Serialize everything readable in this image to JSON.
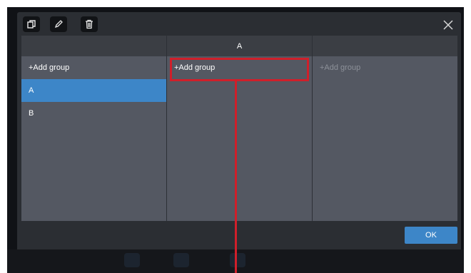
{
  "toolbar": {
    "copy_icon": "copy-icon",
    "edit_icon": "pencil-icon",
    "delete_icon": "trash-icon"
  },
  "columns": [
    {
      "header": "",
      "add_label": "+Add group",
      "items": [
        {
          "label": "A",
          "selected": true
        },
        {
          "label": "B",
          "selected": false
        }
      ]
    },
    {
      "header": "A",
      "add_label": "+Add group",
      "items": []
    },
    {
      "header": "",
      "add_label": "+Add group",
      "items": []
    }
  ],
  "footer": {
    "ok_label": "OK"
  },
  "colors": {
    "accent": "#3d86c8",
    "highlight": "#d01f2a",
    "panel": "#545862",
    "header": "#3b3e44"
  }
}
